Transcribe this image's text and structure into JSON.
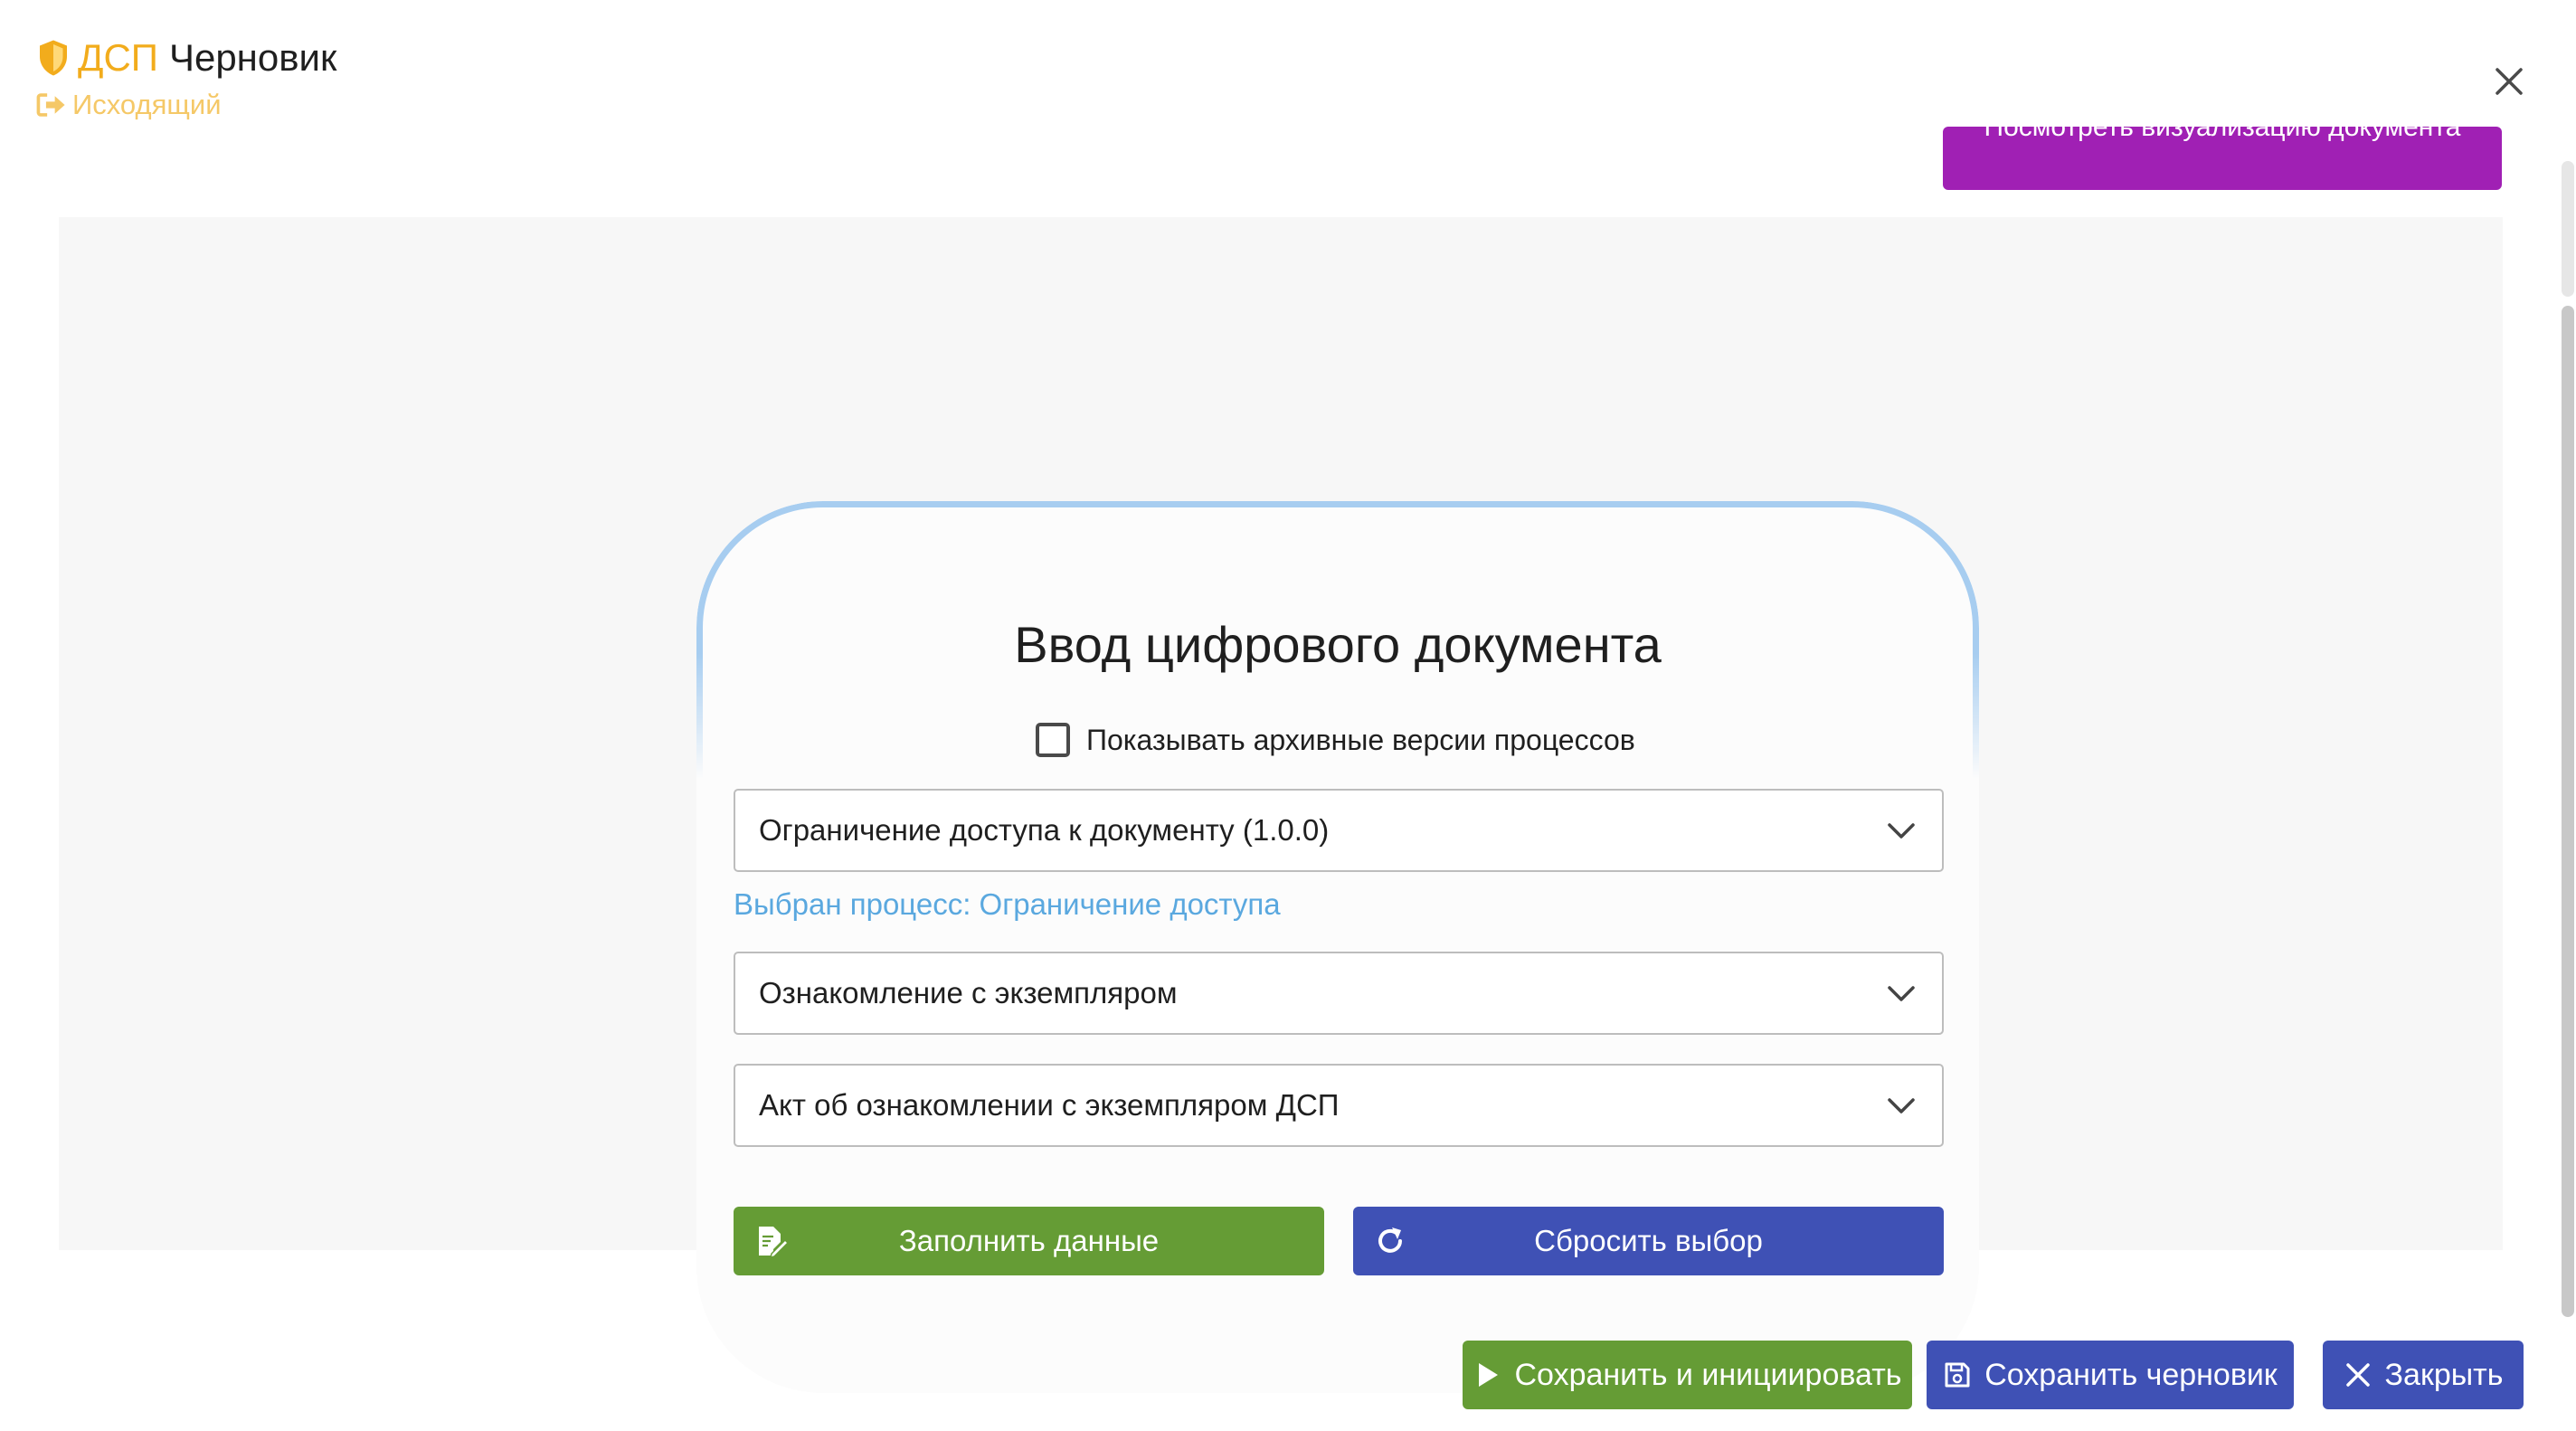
{
  "header": {
    "classification": "ДСП",
    "status": "Черновик",
    "direction": "Исходящий",
    "shield_icon_color": "#f2ac1c",
    "direction_color": "#f5c867"
  },
  "top_button": {
    "label": "Посмотреть визуализацию документа",
    "color": "#a020b4"
  },
  "card": {
    "title": "Ввод цифрового документа",
    "archive_checkbox_label": "Показывать архивные версии процессов",
    "archive_checked": false,
    "process_select": "Ограничение доступа к документу (1.0.0)",
    "chosen_process": "Выбран процесс: Ограничение доступа",
    "stage_select": "Ознакомление с экземпляром",
    "template_select": "Акт об ознакомлении с экземпляром ДСП",
    "fill_button": "Заполнить данные",
    "reset_button": "Сбросить выбор"
  },
  "footer": {
    "save_init": "Сохранить и инициировать",
    "save_draft": "Сохранить черновик",
    "close": "Закрыть"
  },
  "colors": {
    "green": "#659c35",
    "indigo": "#3f51b5",
    "link_blue": "#5aa8df"
  }
}
